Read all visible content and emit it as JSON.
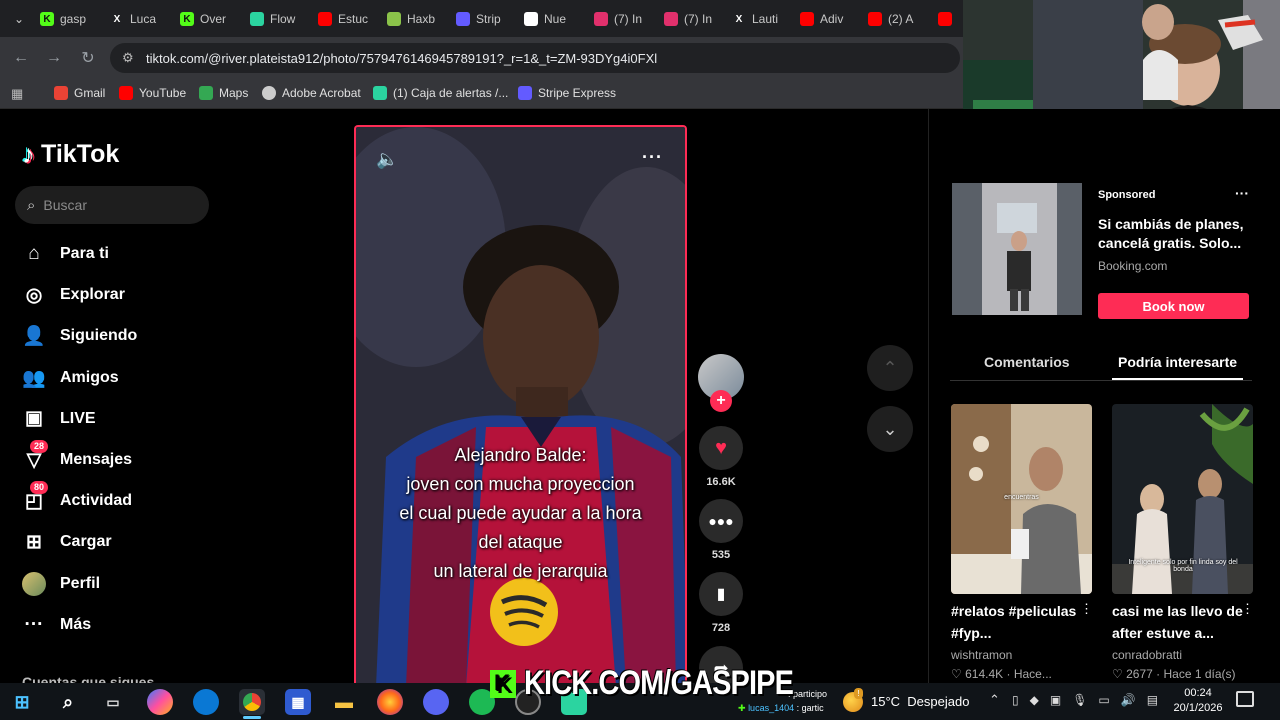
{
  "browser": {
    "tabs": [
      {
        "label": "gasp",
        "icon": "kick-icon",
        "color": "#53fc18"
      },
      {
        "label": "Luca",
        "icon": "x-icon",
        "color": "#ffffff"
      },
      {
        "label": "Over",
        "icon": "kick-icon",
        "color": "#53fc18"
      },
      {
        "label": "Flow",
        "icon": "flow-icon",
        "color": "#2bd4a0"
      },
      {
        "label": "Estuc",
        "icon": "youtube-icon",
        "color": "#ff0000"
      },
      {
        "label": "Haxb",
        "icon": "haxball-icon",
        "color": "#8bc34a"
      },
      {
        "label": "Strip",
        "icon": "stripe-icon",
        "color": "#635bff"
      },
      {
        "label": "Nue",
        "icon": "github-icon",
        "color": "#ffffff"
      },
      {
        "label": "(7) In",
        "icon": "instagram-icon",
        "color": "#e1306c"
      },
      {
        "label": "(7) In",
        "icon": "instagram-icon",
        "color": "#e1306c"
      },
      {
        "label": "Lauti",
        "icon": "x-icon",
        "color": "#ffffff"
      },
      {
        "label": "Adiv",
        "icon": "youtube-icon",
        "color": "#ff0000"
      },
      {
        "label": "(2) A",
        "icon": "youtube-icon",
        "color": "#ff0000"
      }
    ],
    "url": "tiktok.com/@river.plateista912/photo/7579476146945789191?_r=1&_t=ZM-93DYg4i0FXl",
    "bookmarks": [
      {
        "label": "Gmail",
        "icon": "gmail-icon",
        "color": "#ea4335"
      },
      {
        "label": "YouTube",
        "icon": "youtube-icon",
        "color": "#ff0000"
      },
      {
        "label": "Maps",
        "icon": "maps-icon",
        "color": "#34a853"
      },
      {
        "label": "Adobe Acrobat",
        "icon": "acrobat-icon",
        "color": "#cccccc"
      },
      {
        "label": "(1) Caja de alertas /...",
        "icon": "alerts-icon",
        "color": "#2bd4a0"
      },
      {
        "label": "Stripe Express",
        "icon": "stripe-icon",
        "color": "#635bff"
      }
    ]
  },
  "tiktok": {
    "logo": "TikTok",
    "search_placeholder": "Buscar",
    "nav": [
      {
        "label": "Para ti",
        "icon": "home-icon",
        "badge": ""
      },
      {
        "label": "Explorar",
        "icon": "compass-icon",
        "badge": ""
      },
      {
        "label": "Siguiendo",
        "icon": "following-icon",
        "badge": ""
      },
      {
        "label": "Amigos",
        "icon": "friends-icon",
        "badge": ""
      },
      {
        "label": "LIVE",
        "icon": "live-icon",
        "badge": ""
      },
      {
        "label": "Mensajes",
        "icon": "messages-icon",
        "badge": "28"
      },
      {
        "label": "Actividad",
        "icon": "activity-icon",
        "badge": "80"
      },
      {
        "label": "Cargar",
        "icon": "upload-icon",
        "badge": ""
      },
      {
        "label": "Perfil",
        "icon": "avatar-icon",
        "badge": ""
      },
      {
        "label": "Más",
        "icon": "more-icon",
        "badge": ""
      }
    ],
    "following_heading": "Cuentas que sigues",
    "video": {
      "caption_lines": [
        "Alejandro Balde:",
        "joven con mucha proyeccion",
        "el cual puede ayudar a la hora",
        "del ataque",
        "un lateral de jerarquia"
      ],
      "likes": "16.6K",
      "comments": "535",
      "saves": "728"
    },
    "sponsored": {
      "label": "Sponsored",
      "title": "Si cambiás de planes, cancelá gratis. Solo...",
      "domain": "Booking.com",
      "cta": "Book now",
      "brand_color": "#fe2c55"
    },
    "side_tabs": [
      "Comentarios",
      "Podría interesarte"
    ],
    "suggested": [
      {
        "title": "#relatos #peliculas #fyp...",
        "author": "wishtramon",
        "likes": "614.4K",
        "time": "Hace...",
        "overlay": "encuentras"
      },
      {
        "title": "casi me las llevo de after estuve a...",
        "author": "conradobratti",
        "likes": "2677",
        "time": "Hace 1 día(s)",
        "overlay": "Inteligente solo por fin linda soy del bonda"
      }
    ]
  },
  "overlay": {
    "kick_text": "KICK.COM/GASPIPE",
    "chat_line1": ": participo",
    "chat_user2": "lucas_1404",
    "chat_line2": ": gartic"
  },
  "taskbar": {
    "weather": "15°C  Despejado",
    "time": "00:24",
    "date": "20/1/2026"
  }
}
